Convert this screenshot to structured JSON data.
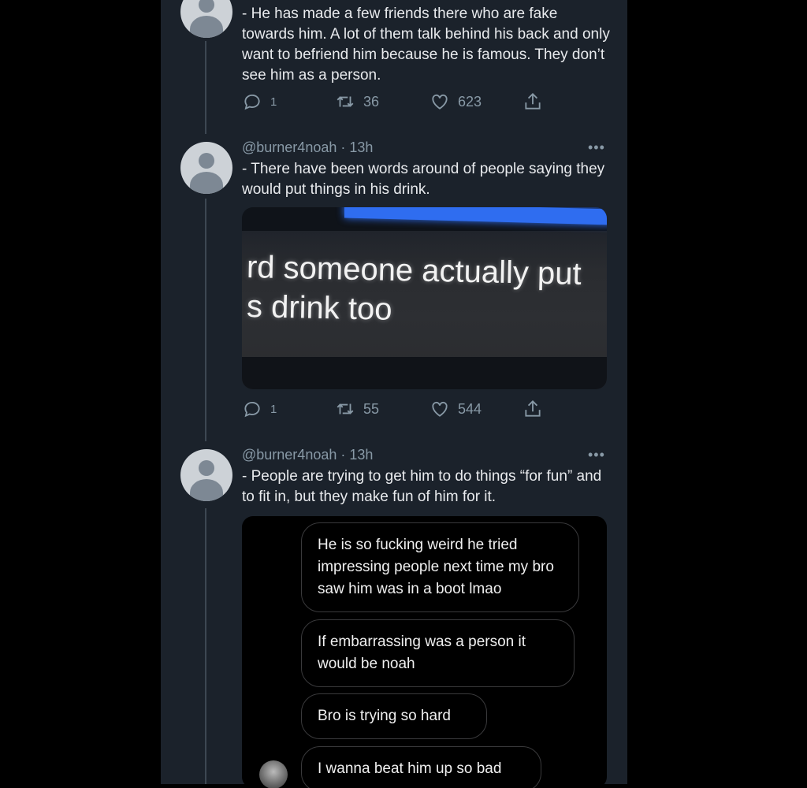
{
  "tweets": [
    {
      "text": "- He has made a few friends there who are fake towards him. A lot of them talk behind his back and only want to befriend him because he is famous. They don’t see him as a person.",
      "replies": "1",
      "retweets": "36",
      "likes": "623"
    },
    {
      "handle": "@burner4noah · 13h",
      "more": "•••",
      "text": "- There have been words around of people saying they would put things in his drink.",
      "photo_lines": [
        "rd someone actually put",
        "s drink too"
      ],
      "replies": "1",
      "retweets": "55",
      "likes": "544"
    },
    {
      "handle": "@burner4noah · 13h",
      "more": "•••",
      "text": "- People are trying to get him to do things “for fun” and to fit in, but they make fun of him for it.",
      "chat_messages": [
        "He is so fucking weird he tried impressing people next time my bro saw him was in a boot lmao",
        "If embarrassing was a person it would be noah",
        "Bro is trying so hard",
        "I wanna beat him up so bad"
      ]
    }
  ],
  "icons": {
    "reply": "reply-icon",
    "retweet": "retweet-icon",
    "like": "heart-icon",
    "share": "share-icon",
    "avatar": "default-avatar-icon"
  },
  "colors": {
    "background": "#1b222b",
    "muted": "#8899a6",
    "text": "#e8eaed"
  }
}
